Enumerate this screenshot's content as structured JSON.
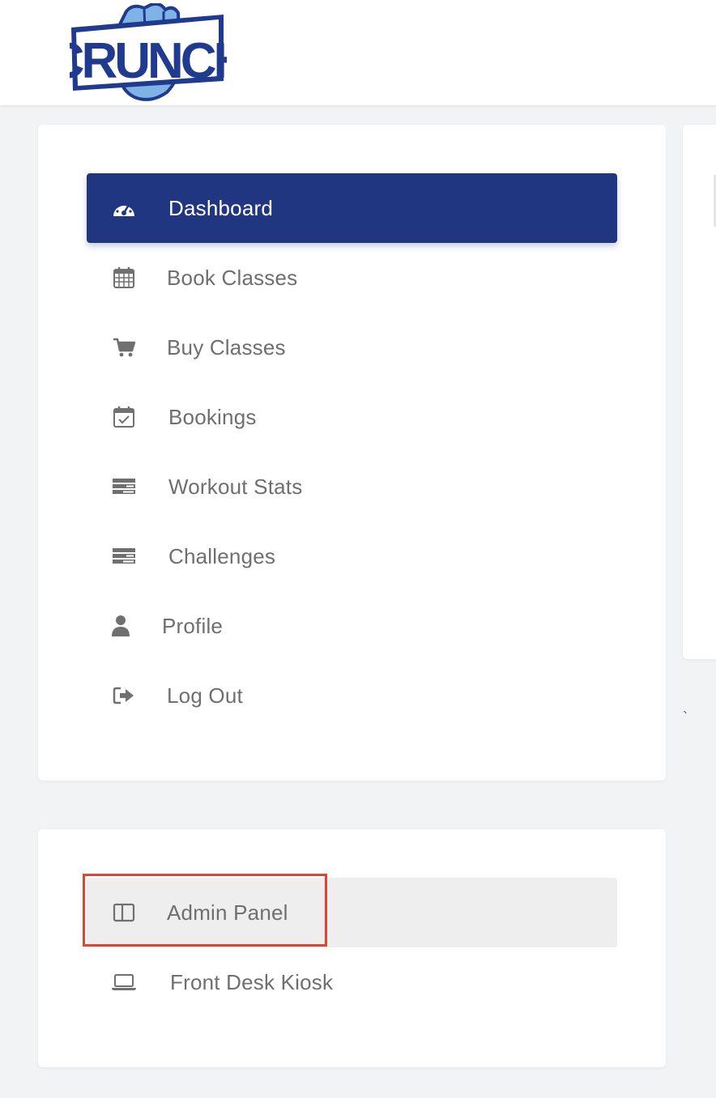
{
  "brand": {
    "logo_text": "CRUNCH",
    "colors": {
      "primary": "#213680",
      "logo_blue": "#1f3a8f",
      "logo_light": "#7fb2e5",
      "highlight": "#e0452f"
    }
  },
  "main_nav": {
    "items": [
      {
        "label": "Dashboard",
        "icon": "dashboard-gauge-icon",
        "active": true
      },
      {
        "label": "Book Classes",
        "icon": "calendar-icon"
      },
      {
        "label": "Buy Classes",
        "icon": "shopping-cart-icon"
      },
      {
        "label": "Bookings",
        "icon": "calendar-check-icon"
      },
      {
        "label": "Workout Stats",
        "icon": "stats-bars-icon"
      },
      {
        "label": "Challenges",
        "icon": "challenges-bars-icon"
      },
      {
        "label": "Profile",
        "icon": "user-icon"
      },
      {
        "label": "Log Out",
        "icon": "sign-out-icon"
      }
    ]
  },
  "admin_nav": {
    "items": [
      {
        "label": "Admin Panel",
        "icon": "columns-icon",
        "hovered": true,
        "highlighted": true
      },
      {
        "label": "Front Desk Kiosk",
        "icon": "laptop-icon"
      }
    ]
  },
  "stray_mark": "`"
}
